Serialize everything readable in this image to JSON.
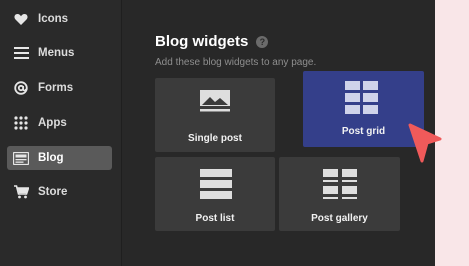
{
  "sidebar": {
    "items": [
      {
        "label": "Icons",
        "icon": "heart-icon"
      },
      {
        "label": "Menus",
        "icon": "menu-icon"
      },
      {
        "label": "Forms",
        "icon": "at-sign-icon"
      },
      {
        "label": "Apps",
        "icon": "grid-dots-icon"
      },
      {
        "label": "Blog",
        "icon": "blog-icon",
        "active": true
      },
      {
        "label": "Store",
        "icon": "cart-icon"
      }
    ]
  },
  "main": {
    "title": "Blog widgets",
    "help": "?",
    "subtitle": "Add these blog widgets to any page.",
    "widgets": [
      {
        "label": "Single post",
        "icon": "single-post-icon"
      },
      {
        "label": "Post grid",
        "icon": "post-grid-icon",
        "selected": true
      },
      {
        "label": "Post list",
        "icon": "post-list-icon"
      },
      {
        "label": "Post gallery",
        "icon": "post-gallery-icon"
      }
    ]
  },
  "colors": {
    "selected_card": "#343f8a",
    "cursor": "#f05a5a",
    "page_background": "#f9e6e8"
  }
}
